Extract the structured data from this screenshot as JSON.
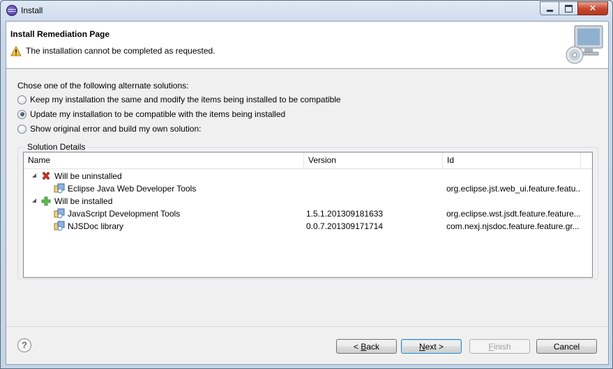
{
  "window": {
    "title": "Install"
  },
  "header": {
    "page_title": "Install Remediation Page",
    "message": "The installation cannot be completed as requested."
  },
  "options": {
    "prompt": "Chose one of the following alternate solutions:",
    "items": [
      {
        "label": "Keep my installation the same and modify the items being installed to be compatible",
        "checked": false
      },
      {
        "label": "Update my installation to be compatible with the items being installed",
        "checked": true
      },
      {
        "label": "Show original error and build my own solution:",
        "checked": false
      }
    ]
  },
  "details": {
    "group_label": "Solution Details",
    "columns": [
      "Name",
      "Version",
      "Id"
    ],
    "rows": [
      {
        "type": "group",
        "icon": "remove-x-icon",
        "name": "Will be uninstalled",
        "version": "",
        "id": ""
      },
      {
        "type": "item",
        "icon": "feature-icon",
        "name": "Eclipse Java Web Developer Tools",
        "version": "",
        "id": "org.eclipse.jst.web_ui.feature.featu..."
      },
      {
        "type": "group",
        "icon": "add-plus-icon",
        "name": "Will be installed",
        "version": "",
        "id": ""
      },
      {
        "type": "item",
        "icon": "feature-icon",
        "name": "JavaScript Development Tools",
        "version": "1.5.1.201309181633",
        "id": "org.eclipse.wst.jsdt.feature.feature...."
      },
      {
        "type": "item",
        "icon": "feature-icon",
        "name": "NJSDoc library",
        "version": "0.0.7.201309171714",
        "id": "com.nexj.njsdoc.feature.feature.gr..."
      }
    ]
  },
  "buttons": {
    "back": {
      "label_pre": "< ",
      "label_mnemonic": "B",
      "label_post": "ack"
    },
    "next": {
      "label_mnemonic": "N",
      "label_post": "ext >"
    },
    "finish": {
      "label_mnemonic": "F",
      "label_post": "inish"
    },
    "cancel": "Cancel"
  },
  "colors": {
    "accent": "#3c7fb1",
    "remove": "#d0302a",
    "add": "#3aa33a"
  }
}
